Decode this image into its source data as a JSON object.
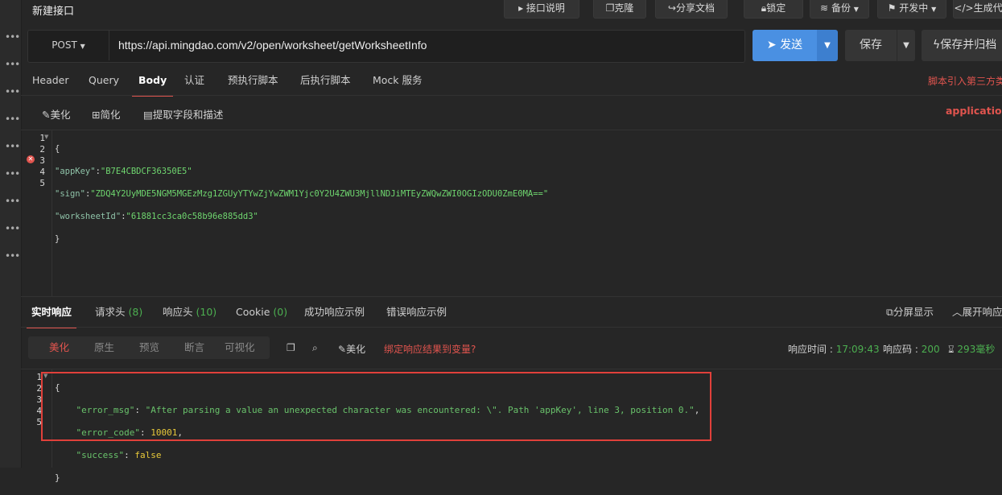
{
  "app": {
    "title": "新建接口"
  },
  "toolbar": {
    "doc_label": "接口说明",
    "clone_label": "克隆",
    "share_label": "分享文档",
    "lock_label": "锁定",
    "backup_label": "备份",
    "status_label": "开发中",
    "generate_label": "生成代"
  },
  "request": {
    "method": "POST",
    "url": "https://api.mingdao.com/v2/open/worksheet/getWorksheetInfo",
    "send_label": "发送",
    "save_label": "保存",
    "save_archive_label": "保存并归档"
  },
  "request_tabs": [
    "Header",
    "Query",
    "Body",
    "认证",
    "预执行脚本",
    "后执行脚本",
    "Mock 服务"
  ],
  "script_warning": "脚本引入第三方类",
  "body_tools": {
    "beautify": "美化",
    "simplify": "简化",
    "extract": "提取字段和描述",
    "content_type": "application/j"
  },
  "request_body": {
    "line_numbers": [
      "1",
      "2",
      "3",
      "4",
      "5"
    ],
    "open": "{",
    "k1": "\"appKey\"",
    "v1": "\"B7E4CBDCF36350E5\"",
    "k2": "\"sign\"",
    "v2": "\"ZDQ4Y2UyMDE5NGM5MGEzMzg1ZGUyYTYwZjYwZWM1Yjc0Y2U4ZWU3MjllNDJiMTEyZWQwZWI0OGIzODU0ZmE0MA==\"",
    "k3": "\"worksheetId\"",
    "v3": "\"61881cc3ca0c58b96e885dd3\"",
    "close": "}"
  },
  "response_tabs": {
    "realtime": "实时响应",
    "req_headers": "请求头",
    "req_headers_count": "(8)",
    "resp_headers": "响应头",
    "resp_headers_count": "(10)",
    "cookie": "Cookie",
    "cookie_count": "(0)",
    "success_example": "成功响应示例",
    "error_example": "错误响应示例",
    "split_view": "分屏显示",
    "expand": "展开响应"
  },
  "view_modes": [
    "美化",
    "原生",
    "预览",
    "断言",
    "可视化"
  ],
  "response_tools": {
    "beautify": "美化",
    "bind_var": "绑定响应结果到变量?",
    "time_label": "响应时间 :",
    "time_value": "17:09:43",
    "code_label": "响应码 :",
    "code_value": "200",
    "duration": "293毫秒"
  },
  "response_body": {
    "line_numbers": [
      "1",
      "2",
      "3",
      "4",
      "5"
    ],
    "open": "{",
    "k1": "\"error_msg\"",
    "v1": "\"After parsing a value an unexpected character was encountered: \\\". Path 'appKey', line 3, position 0.\"",
    "k2": "\"error_code\"",
    "v2": "10001",
    "k3": "\"success\"",
    "v3": "false",
    "close": "}"
  },
  "colors": {
    "accent": "#e0544e",
    "primary": "#4a90e2",
    "ok": "#4caf50"
  }
}
